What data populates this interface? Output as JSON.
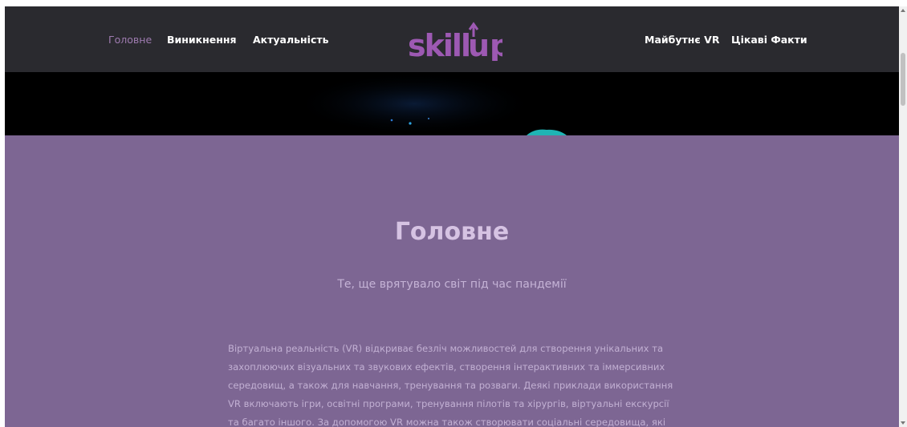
{
  "nav": {
    "left_links": [
      "Головне",
      "Виникнення",
      "Актуальність"
    ],
    "right_links": [
      "Майбутнє VR",
      "Цікаві Факти"
    ],
    "logo_text": "skillup"
  },
  "main": {
    "title": "Головне",
    "subtitle": "Те, ще врятувало світ під час пандемії",
    "paragraph": "Віртуальна реальність (VR) відкриває безліч можливостей для створення унікальних та захоплюючих візуальних та звукових ефектів, створення інтерактивних та іммерсивних середовищ, а також для навчання, тренування та розваги. Деякі приклади використання VR включають ігри, освітні програми, тренування пілотів та хірургів, віртуальні екскурсії та багато іншого. За допомогою VR можна також створювати соціальні середовища, які"
  },
  "colors": {
    "nav_bg": "#2a2a2f",
    "accent": "#9d59b3",
    "section_bg": "#7d6693"
  }
}
